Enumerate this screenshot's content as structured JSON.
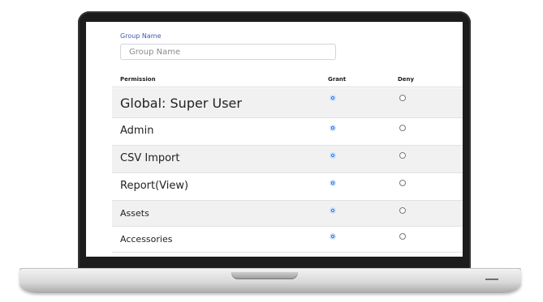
{
  "form": {
    "group_label": "Group Name",
    "group_placeholder": "Group Name"
  },
  "table": {
    "headers": {
      "permission": "Permission",
      "grant": "Grant",
      "deny": "Deny"
    },
    "rows": [
      {
        "label": "Global: Super User",
        "grant": true,
        "deny": false
      },
      {
        "label": "Admin",
        "grant": true,
        "deny": false
      },
      {
        "label": "CSV Import",
        "grant": true,
        "deny": false
      },
      {
        "label": "Report(View)",
        "grant": true,
        "deny": false
      },
      {
        "label": "Assets",
        "grant": true,
        "deny": false
      },
      {
        "label": "Accessories",
        "grant": true,
        "deny": false
      }
    ]
  },
  "colors": {
    "label_blue": "#3c5bb0",
    "radio_selected": "#1a73e8",
    "row_alt": "#f1f1f1"
  }
}
